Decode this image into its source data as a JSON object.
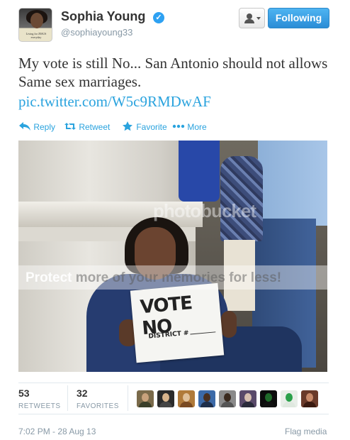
{
  "user": {
    "name": "Sophia Young",
    "handle": "@sophiayoung33",
    "avatar_caption": "Living for JESUS everyday"
  },
  "buttons": {
    "follow_label": "Following"
  },
  "tweet": {
    "text": "My vote is still No... San Antonio should not allows Same sex marriages.",
    "link": "pic.twitter.com/W5c9RMDwAF"
  },
  "actions": {
    "reply": "Reply",
    "retweet": "Retweet",
    "favorite": "Favorite",
    "more": "More"
  },
  "photo": {
    "sign_title": "VOTE NO",
    "sign_district": "DISTRICT #",
    "watermark_logo": "photobucket",
    "watermark_text_1": "Protect ",
    "watermark_text_2": "more of your memories for less!"
  },
  "stats": {
    "retweets_count": "53",
    "retweets_label": "RETWEETS",
    "favorites_count": "32",
    "favorites_label": "FAVORITES"
  },
  "faces": [
    {
      "bg": "#7a6a4a",
      "head": "#c9a27c",
      "shirt": "#3a3f2a"
    },
    {
      "bg": "#2b2b2b",
      "head": "#d8b48c",
      "shirt": "#444"
    },
    {
      "bg": "#b07a3a",
      "head": "#e0c09a",
      "shirt": "#7a4a22"
    },
    {
      "bg": "#3c6aa8",
      "head": "#4a3020",
      "shirt": "#1e2e4a"
    },
    {
      "bg": "#8a8a8a",
      "head": "#3a2a1e",
      "shirt": "#555"
    },
    {
      "bg": "#5a4a6a",
      "head": "#d8c0b0",
      "shirt": "#2a2a3a"
    },
    {
      "bg": "#0c0c0c",
      "head": "#1f6a2a",
      "shirt": "#111"
    },
    {
      "bg": "#e8eee8",
      "head": "#2aa04a",
      "shirt": "#dfe8df"
    },
    {
      "bg": "#6a3a2a",
      "head": "#c98a6a",
      "shirt": "#3a1a10"
    }
  ],
  "meta": {
    "timestamp": "7:02 PM - 28 Aug 13",
    "flag_label": "Flag media"
  },
  "colors": {
    "link": "#2aa3de",
    "follow_button": "#2b8dd6",
    "verified": "#2ea1f2",
    "muted": "#8899a6"
  }
}
